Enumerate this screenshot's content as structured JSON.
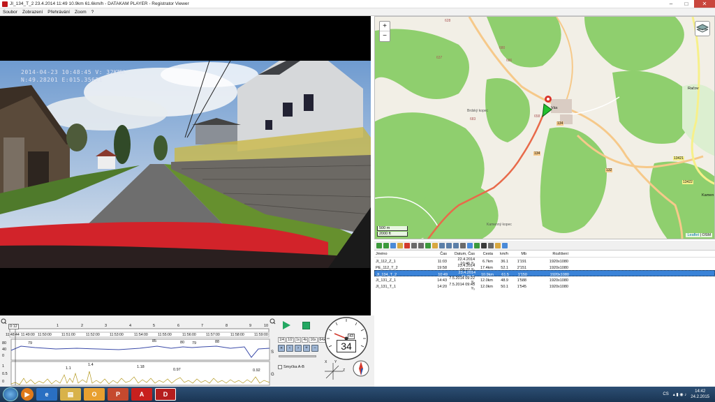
{
  "window": {
    "title": "JI_134_T_2    23.4.2014 11:49    10.9km    61.6km/h  -  DATAKAM PLAYER - Registrator Viewer"
  },
  "menu": [
    "Soubor",
    "Zobrazení",
    "Přehrávání",
    "Zoom",
    "?"
  ],
  "video": {
    "overlay_line1": "2014-04-23  10:48:45 V: 32KMH",
    "overlay_line2": "N:49.28201    E:015.35621"
  },
  "map": {
    "zoom_in": "+",
    "zoom_out": "−",
    "scale_m": "500 m",
    "scale_ft": "2000 ft",
    "attribution_link": "Leaflet",
    "attribution_sep": " | ",
    "attribution_osm": "OSM",
    "labels": {
      "town": "Vás",
      "right_town": "Račov",
      "right_town2": "Kamen",
      "hill1": "Brdský kopec",
      "hill2": "Kamenný kopec"
    },
    "road_numbers": [
      "134",
      "134",
      "132",
      "13421",
      "13422"
    ],
    "elevations": [
      "628",
      "680",
      "686",
      "637",
      "658",
      "683"
    ]
  },
  "table": {
    "headers": [
      "Jméno",
      "Čas",
      "Datum, Čas",
      "Cesta",
      "km/h",
      "Mb",
      "Rozlišení"
    ],
    "rows": [
      [
        "JI_112_Z_1",
        "11:03",
        "22.4.2014 10:46 ⁰⁄₀",
        "6.7km",
        "36.1",
        "1'191",
        "1920x1080"
      ],
      [
        "PE_112_T_2",
        "19:58",
        "23.4.2014 06:27 ⁰⁄₀",
        "17.4km",
        "52.1",
        "2'151",
        "1920x1080"
      ],
      [
        "JI_134_T_2",
        "10:49",
        "23.4.2014 11:49 ⁰⁄₀",
        "10.9km",
        "61.5",
        "1'150",
        "1920x1080"
      ],
      [
        "JI_131_Z_1",
        "14:43",
        "7.5.2014 09:22 ⁰⁄₀",
        "12.0km",
        "48.9",
        "1'588",
        "1920x1080"
      ],
      [
        "JI_131_T_1",
        "14:20",
        "7.5.2014 09:45 ⁰⁄₀",
        "12.0km",
        "50.1",
        "1'545",
        "1920x1080"
      ]
    ],
    "selected_index": 2
  },
  "timeline": {
    "ruler": [
      "0",
      "1",
      "2",
      "3",
      "4",
      "5",
      "6",
      "7",
      "8",
      "9",
      "10"
    ],
    "current": "0:12",
    "times": [
      "11:48:44",
      "11:49:00",
      "11:50:00",
      "11:51:00",
      "11:52:00",
      "11:53:00",
      "11:54:00",
      "11:55:00",
      "11:56:00",
      "11:57:00",
      "11:58:00",
      "11:59:00"
    ],
    "speed_axis": [
      "80",
      "40",
      "0"
    ],
    "speed_unit": "S",
    "speed_labels": [
      "79",
      "85",
      "80",
      "79",
      "88"
    ],
    "g_axis": [
      "1",
      "0.5",
      "0"
    ],
    "g_unit": "G",
    "g_labels": [
      "1.1",
      "1.4",
      "1.18",
      "0.97",
      "0.92"
    ]
  },
  "controls": {
    "speeds": [
      "1/4",
      "1/2",
      "1x",
      "4x",
      "16x",
      "64x"
    ],
    "ab_label": "Smyčka A-B"
  },
  "gauge": {
    "speed": "34",
    "odo": "43",
    "accel_labels": [
      "X",
      "Y",
      "Z"
    ]
  },
  "taskbar": {
    "lang": "CS",
    "time": "14:42",
    "date": "24.2.2015"
  },
  "colors": {
    "selection": "#3a83d8",
    "route": "#e86a4a",
    "map_green": "#8fcf6e",
    "play": "#23a862"
  }
}
